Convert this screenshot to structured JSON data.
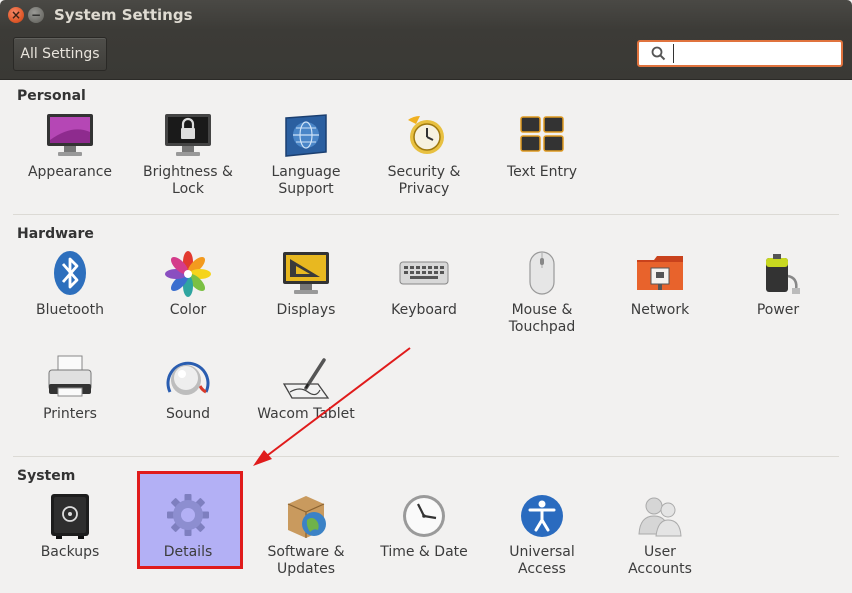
{
  "window": {
    "title": "System Settings",
    "close_glyph": "×",
    "min_glyph": "−"
  },
  "toolbar": {
    "all_settings_label": "All Settings",
    "search_placeholder": "",
    "search_value": ""
  },
  "sections": [
    {
      "label": "Personal",
      "items": [
        "Appearance",
        "Brightness & Lock",
        "Language Support",
        "Security & Privacy",
        "Text Entry"
      ]
    },
    {
      "label": "Hardware",
      "items": [
        "Bluetooth",
        "Color",
        "Displays",
        "Keyboard",
        "Mouse & Touchpad",
        "Network",
        "Power",
        "Printers",
        "Sound",
        "Wacom Tablet"
      ]
    },
    {
      "label": "System",
      "items": [
        "Backups",
        "Details",
        "Software & Updates",
        "Time & Date",
        "Universal Access",
        "User Accounts"
      ]
    }
  ],
  "labels": {
    "appearance": [
      "Appearance"
    ],
    "brightness": [
      "Brightness &",
      "Lock"
    ],
    "language": [
      "Language",
      "Support"
    ],
    "security": [
      "Security &",
      "Privacy"
    ],
    "textentry": [
      "Text Entry"
    ],
    "bluetooth": [
      "Bluetooth"
    ],
    "color": [
      "Color"
    ],
    "displays": [
      "Displays"
    ],
    "keyboard": [
      "Keyboard"
    ],
    "mouse": [
      "Mouse &",
      "Touchpad"
    ],
    "network": [
      "Network"
    ],
    "power": [
      "Power"
    ],
    "printers": [
      "Printers"
    ],
    "sound": [
      "Sound"
    ],
    "wacom": [
      "Wacom Tablet"
    ],
    "backups": [
      "Backups"
    ],
    "details": [
      "Details"
    ],
    "software": [
      "Software &",
      "Updates"
    ],
    "timedate": [
      "Time & Date"
    ],
    "universal": [
      "Universal",
      "Access"
    ],
    "users": [
      "User",
      "Accounts"
    ]
  },
  "colors": {
    "highlight": "#b3b0f5",
    "annotation": "#e01b1b",
    "search_border": "#e0733e",
    "titlebar": "#3c3b37"
  }
}
